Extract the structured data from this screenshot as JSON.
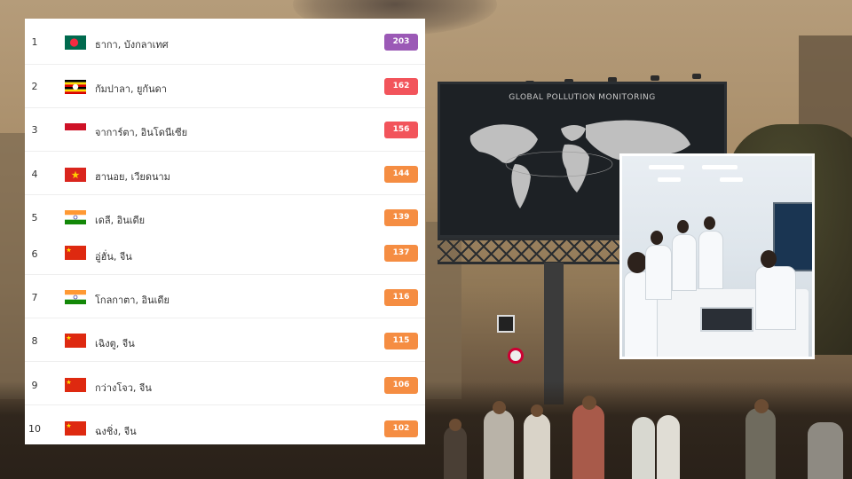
{
  "ranking": {
    "rows": [
      {
        "rank": "1",
        "city": "ธากา, บังกลาเทศ",
        "aqi": "203",
        "flag": "bangladesh-flag-icon",
        "color": "#9b59b6"
      },
      {
        "rank": "2",
        "city": "กัมปาลา, ยูกันดา",
        "aqi": "162",
        "flag": "uganda-flag-icon",
        "color": "#f2545b"
      },
      {
        "rank": "3",
        "city": "จาการ์ตา, อินโดนีเซีย",
        "aqi": "156",
        "flag": "indonesia-flag-icon",
        "color": "#f2545b"
      },
      {
        "rank": "4",
        "city": "ฮานอย, เวียดนาม",
        "aqi": "144",
        "flag": "vietnam-flag-icon",
        "color": "#f58d42"
      },
      {
        "rank": "5",
        "city": "เดลี, อินเดีย",
        "aqi": "139",
        "flag": "india-flag-icon",
        "color": "#f58d42"
      },
      {
        "rank": "6",
        "city": "อู่ฮั่น, จีน",
        "aqi": "137",
        "flag": "china-flag-icon",
        "color": "#f58d42"
      },
      {
        "rank": "7",
        "city": "โกลกาตา, อินเดีย",
        "aqi": "116",
        "flag": "india-flag-icon",
        "color": "#f58d42"
      },
      {
        "rank": "8",
        "city": "เฉิงตู, จีน",
        "aqi": "115",
        "flag": "china-flag-icon",
        "color": "#f58d42"
      },
      {
        "rank": "9",
        "city": "กว่างโจว, จีน",
        "aqi": "106",
        "flag": "china-flag-icon",
        "color": "#f58d42"
      },
      {
        "rank": "10",
        "city": "ฉงชิ่ง, จีน",
        "aqi": "102",
        "flag": "china-flag-icon",
        "color": "#f58d42"
      }
    ]
  },
  "background": {
    "billboard_title": "GLOBAL POLLUTION MONITORING"
  },
  "colors": {
    "purple": "#9b59b6",
    "red": "#f2545b",
    "orange": "#f58d42"
  }
}
